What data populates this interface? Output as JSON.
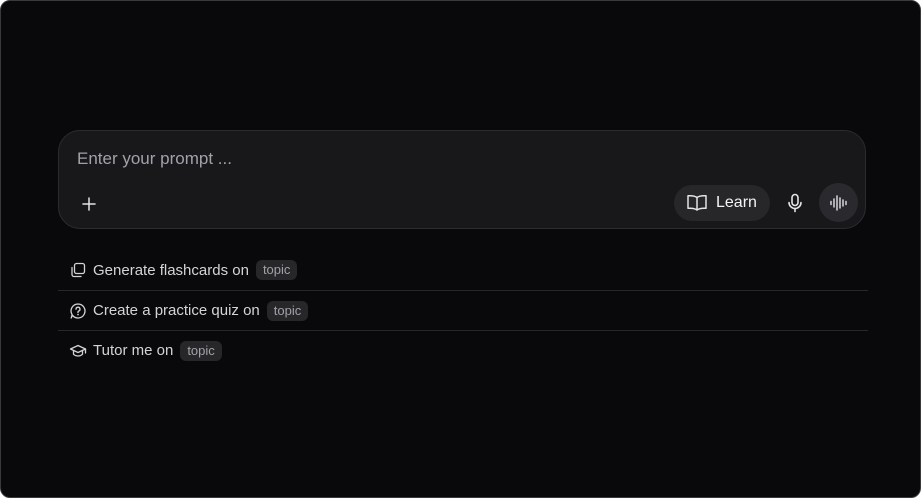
{
  "composer": {
    "placeholder": "Enter your prompt ...",
    "learn_label": "Learn",
    "icons": {
      "add": "plus-icon",
      "learn": "book-open-icon",
      "mic": "microphone-icon",
      "voice": "audio-waveform-icon"
    }
  },
  "suggestions": [
    {
      "text": "Generate flashcards on",
      "chip": "topic",
      "icon": "copy-cards-icon"
    },
    {
      "text": "Create a practice quiz on",
      "chip": "topic",
      "icon": "help-circle-icon"
    },
    {
      "text": "Tutor me on",
      "chip": "topic",
      "icon": "graduation-cap-icon"
    }
  ],
  "colors": {
    "background": "#09090b",
    "composer": "#18181b",
    "chip": "#27272a",
    "text": "#d4d4d8",
    "muted": "#a1a1aa"
  }
}
